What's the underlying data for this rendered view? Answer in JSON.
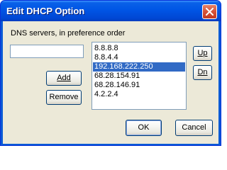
{
  "window": {
    "title": "Edit DHCP Option"
  },
  "icons": {
    "close": "close-icon"
  },
  "form": {
    "label": "DNS servers, in preference order",
    "input_value": "",
    "add_label": "Add",
    "remove_label": "Remove",
    "up_label": "Up",
    "dn_label": "Dn",
    "ok_label": "OK",
    "cancel_label": "Cancel"
  },
  "servers": {
    "items": [
      "8.8.8.8",
      "8.8.4.4",
      "192.168.222.250",
      "68.28.154.91",
      "68.28.146.91",
      "4.2.2.4"
    ],
    "selected_index": 2
  },
  "colors": {
    "title_bar": "#0055e5",
    "selection": "#316ac5",
    "dialog_bg": "#ece9d8"
  }
}
